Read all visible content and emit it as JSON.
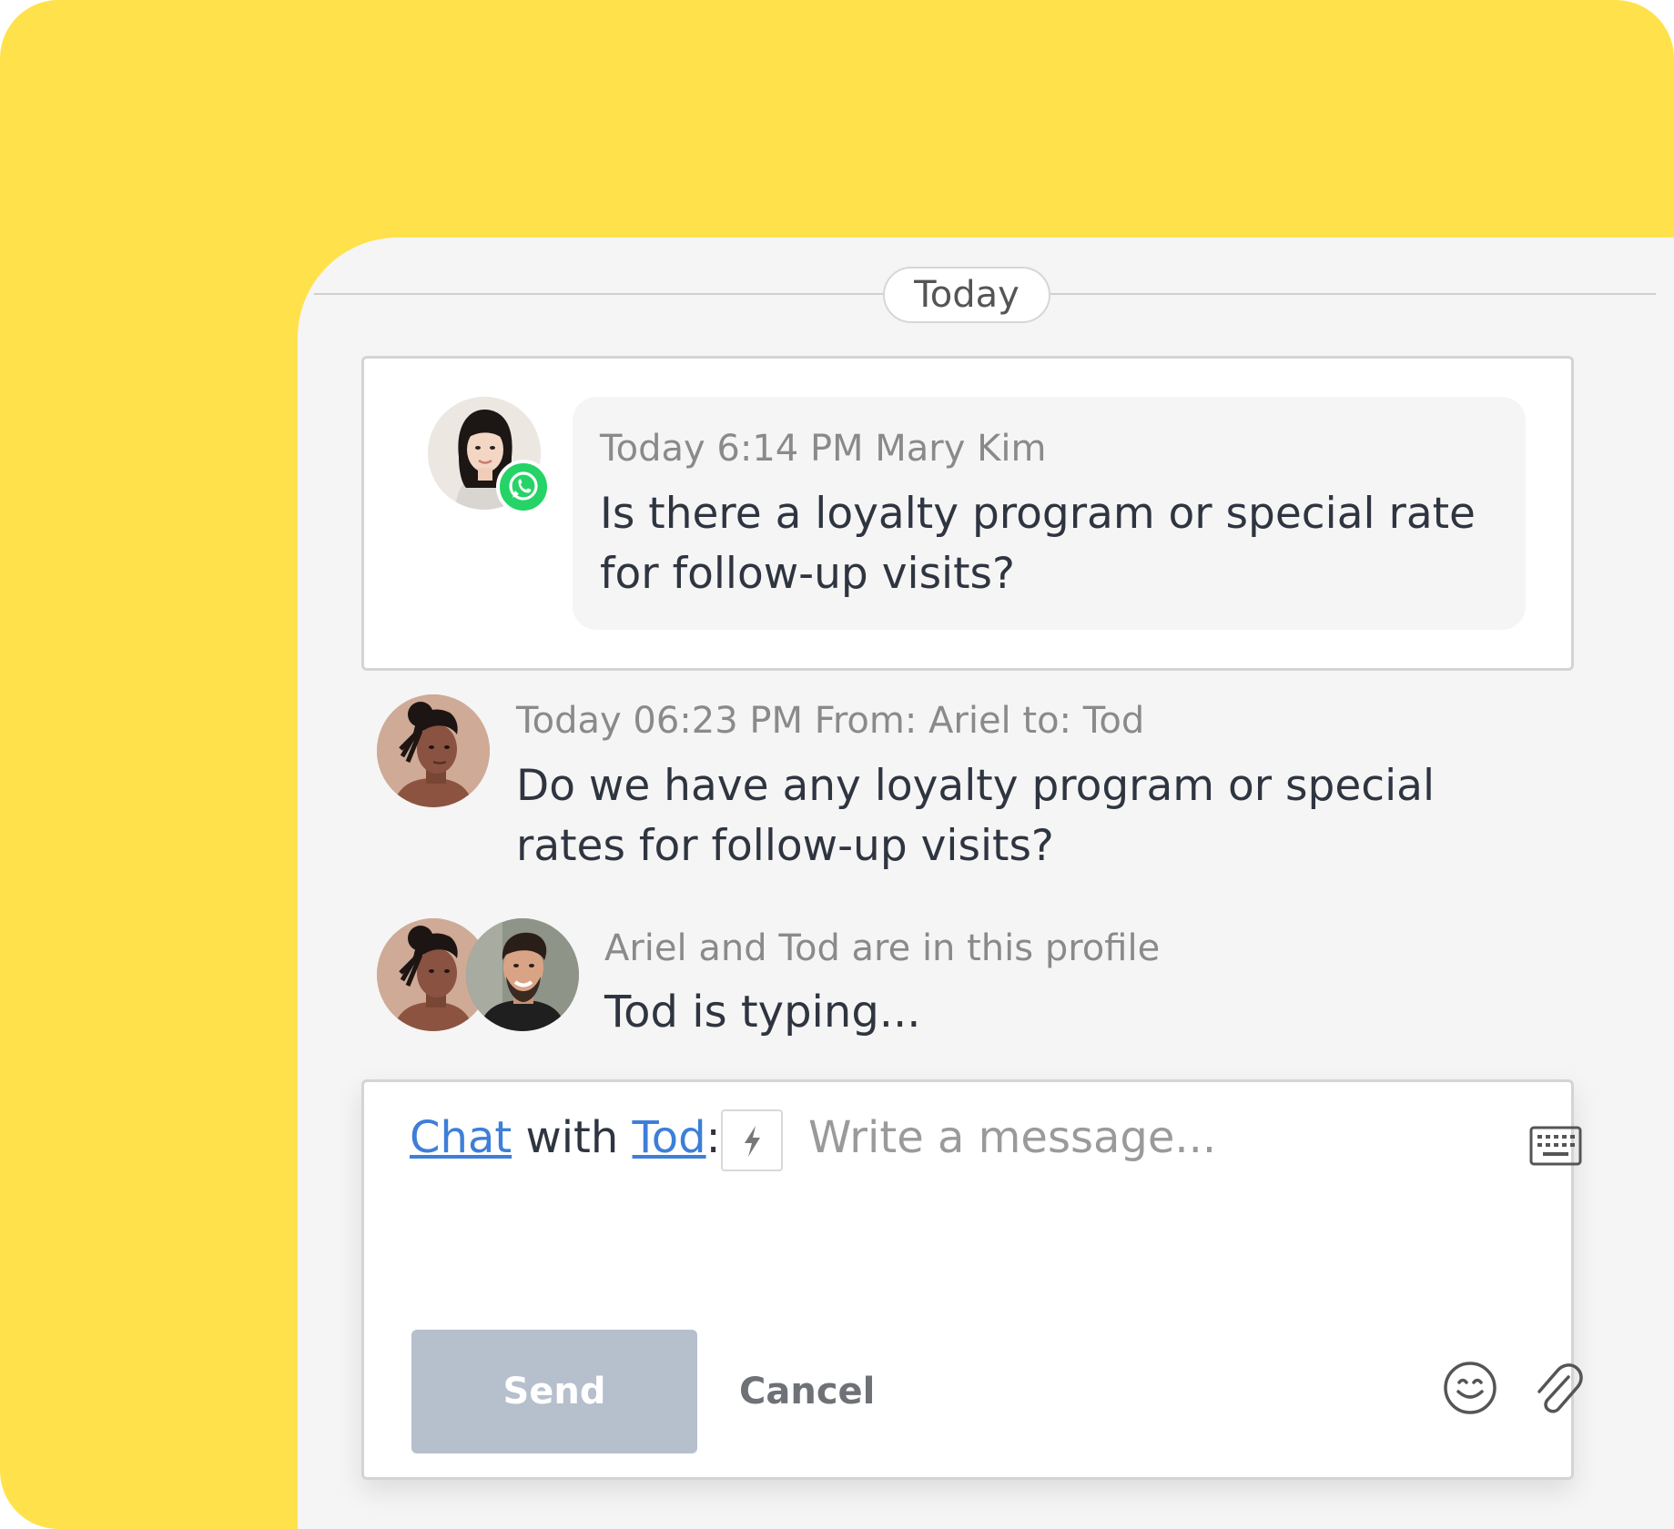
{
  "date_divider": "Today",
  "messages": [
    {
      "meta": "Today 6:14 PM Mary Kim",
      "text": "Is there a loyalty program or special rate for follow-up visits?",
      "avatar": "mary-kim-avatar",
      "channel_icon": "whatsapp-icon"
    },
    {
      "meta": "Today 06:23 PM From: Ariel to: Tod",
      "text": "Do we have any loyalty program or special rates for follow-up visits?",
      "avatar": "ariel-avatar"
    }
  ],
  "presence": {
    "meta": "Ariel and Tod are in this profile",
    "typing": "Tod is typing..."
  },
  "composer": {
    "mode_link": "Chat",
    "with_word": "with",
    "recipient_link": "Tod",
    "colon": ":",
    "placeholder": "Write a message...",
    "send_label": "Send",
    "cancel_label": "Cancel"
  },
  "colors": {
    "background": "#FFE24B",
    "panel": "#F5F5F5",
    "link": "#3d7fd8",
    "send_button": "#B6BFCC",
    "whatsapp": "#25D366"
  }
}
